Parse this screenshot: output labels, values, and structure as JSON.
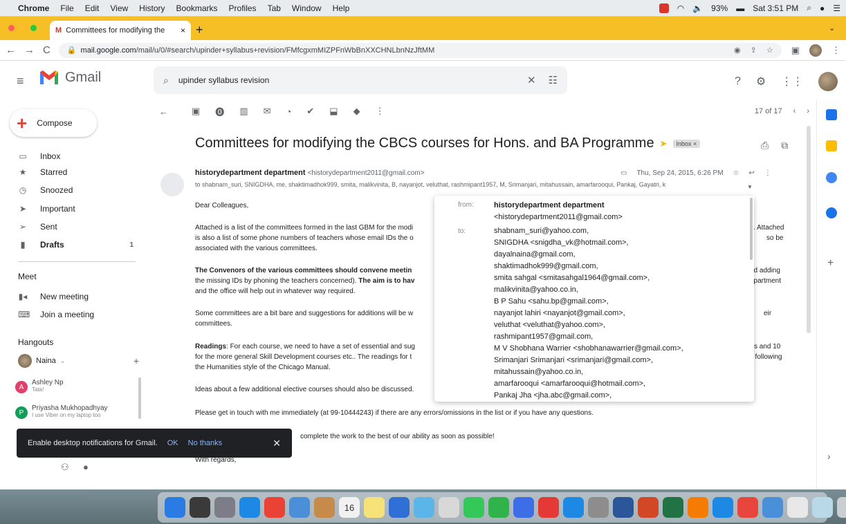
{
  "menubar": {
    "app": "Chrome",
    "items": [
      "File",
      "Edit",
      "View",
      "History",
      "Bookmarks",
      "Profiles",
      "Tab",
      "Window",
      "Help"
    ],
    "battery": "93%",
    "clock": "Sat 3:51 PM"
  },
  "browser": {
    "tab_title": "Committees for modifying the",
    "url_host": "mail.google.com",
    "url_path": "/mail/u/0/#search/upinder+syllabus+revision/FMfcgxmMIZPFnWbBnXXCHNLbnNzJftMM"
  },
  "gmail": {
    "brand": "Gmail",
    "search_query": "upinder syllabus revision",
    "compose_label": "Compose",
    "nav": [
      {
        "label": "Inbox",
        "icon": "inbox-icon"
      },
      {
        "label": "Starred",
        "icon": "star-icon"
      },
      {
        "label": "Snoozed",
        "icon": "clock-icon"
      },
      {
        "label": "Important",
        "icon": "important-icon"
      },
      {
        "label": "Sent",
        "icon": "send-icon"
      },
      {
        "label": "Drafts",
        "icon": "draft-icon",
        "count": "1"
      }
    ],
    "meet": {
      "heading": "Meet",
      "new_meeting": "New meeting",
      "join_meeting": "Join a meeting"
    },
    "hangouts": {
      "heading": "Hangouts",
      "self_name": "Naina",
      "contacts": [
        {
          "initial": "A",
          "name": "Ashley Np",
          "status": "Tata!",
          "color": "#e53e6b"
        },
        {
          "initial": "P",
          "name": "Priyasha Mukhopadhyay",
          "status": "I use Viber on my laptop too",
          "color": "#0f9d58"
        }
      ]
    },
    "pager": "17 of 17"
  },
  "email": {
    "subject": "Committees for modifying the CBCS courses for Hons. and BA Programme",
    "label": "Inbox ×",
    "sender_name": "historydepartment department",
    "sender_email": "<historydepartment2011@gmail.com>",
    "date": "Thu, Sep 24, 2015, 6:26 PM",
    "to_line": "to shabnam_suri, SNIGDHA, me, shaktimadhok999, smita, malikvinita, B, nayanjot, veluthat, rashmipant1957, M, Srimanjari, mitahussain, amarfarooqui, Pankaj, Gayatri, k",
    "body": {
      "p1": "Dear Colleagues,",
      "p2a": "Attached is a list of the committees formed in the last GBM for the modi",
      "p2a_r": "s. Attached",
      "p2b": "is also a list of some phone numbers of teachers whose email IDs the o",
      "p2b_r": "so be",
      "p2c": "associated with the various committees.",
      "p3a": "The Convenors of the various committees should convene meetin",
      "p3a_r": "nd adding",
      "p3b_1": "the missing IDs by phoning the teachers concerned).",
      "p3b_2": " The aim is to hav",
      "p3b_r": "epartment",
      "p3c": "and the office will help out in whatever way required.",
      "p4a": "Some committees are a bit bare and suggestions for additions will be w",
      "p4a_r": "eir",
      "p4b": "committees.",
      "p5a_1": "Readings",
      "p5a_2": ": For each course, we need to have a set of essential and sug",
      "p5a_r": "s and 10",
      "p5b": "for the more general Skill Development courses etc.. The readings for t",
      "p5b_r": ", following",
      "p5c": "the Humanities style of the Chicago Manual.",
      "p6": "Ideas about a few additional elective courses should also be discussed.",
      "p7": "Please get in touch with me immediately (at 99-10444243) if there are any errors/omissions in the list or if you have any questions.",
      "p8": "complete the work to the best of our ability as soon as possible!",
      "p9": "With regards,"
    }
  },
  "popup": {
    "from_label": "from:",
    "from_name": "historydepartment department",
    "from_email": "<historydepartment2011@gmail.com>",
    "to_label": "to:",
    "recipients": [
      "shabnam_suri@yahoo.com,",
      "SNIGDHA <snigdha_vk@hotmail.com>,",
      "dayalnaina@gmail.com,",
      "shaktimadhok999@gmail.com,",
      "smita sahgal <smitasahgal1964@gmail.com>,",
      "malikvinita@yahoo.co.in,",
      "B P Sahu <sahu.bp@gmail.com>,",
      "nayanjot lahiri <nayanjot@gmail.com>,",
      "veluthat <veluthat@yahoo.com>,",
      "rashmipant1957@gmail.com,",
      "M V Shobhana Warrier <shobhanawarrier@gmail.com>,",
      "Srimanjari Srimanjari <srimanjari@gmail.com>,",
      "mitahussain@yahoo.co.in,",
      "amarfarooqui <amarfarooqui@hotmail.com>,",
      "Pankaj Jha <jha.abc@gmail.com>,"
    ]
  },
  "snackbar": {
    "message": "Enable desktop notifications for Gmail.",
    "ok": "OK",
    "no_thanks": "No thanks",
    "close": "✕"
  },
  "dock": {
    "calendar_day": "16",
    "icons": [
      "#2a7be4",
      "#3a3a3a",
      "#7d7d8a",
      "#1e88e5",
      "#ea4335",
      "#4a8fd8",
      "#c68a4a",
      "#f1f1f1",
      "#f7e27a",
      "#2f6fd6",
      "#5bb5e8",
      "#d8d8d8",
      "#34c759",
      "#2fb34a",
      "#3d6ee8",
      "#e53935",
      "#1e88e5",
      "#8d8d8d",
      "#2b579a",
      "#d24726",
      "#217346",
      "#f57c00",
      "#1e88e5",
      "#e8453c",
      "#4a90d9",
      "#e8e8e8",
      "#b9d9e8",
      "#c9ced3"
    ]
  }
}
